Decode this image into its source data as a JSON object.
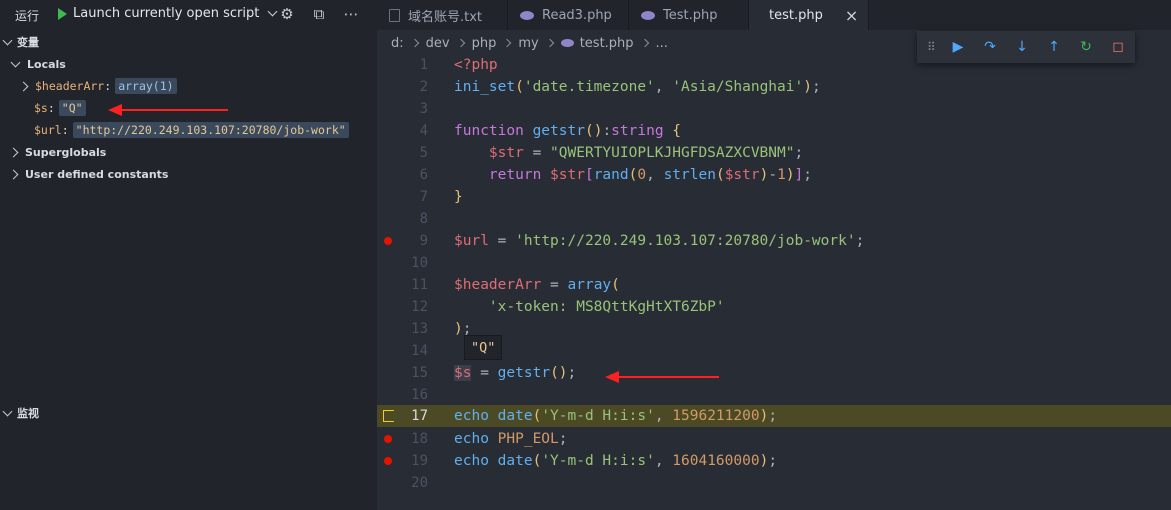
{
  "sidebar": {
    "run_title": "运行",
    "launch_label": "Launch currently open script",
    "variables_title": "变量",
    "locals_label": "Locals",
    "vars": [
      {
        "name": "$headerArr",
        "value": "array(1)"
      },
      {
        "name": "$s",
        "value": "\"Q\""
      },
      {
        "name": "$url",
        "value": "\"http://220.249.103.107:20780/job-work\""
      }
    ],
    "superglobals_label": "Superglobals",
    "constants_label": "User defined constants",
    "watch_title": "监视"
  },
  "tabs": [
    {
      "label": "域名账号.txt",
      "type": "txt"
    },
    {
      "label": "Read3.php",
      "type": "php"
    },
    {
      "label": "Test.php",
      "type": "php"
    },
    {
      "label": "test.php",
      "type": "php",
      "active": true,
      "close": "×"
    }
  ],
  "breadcrumb": [
    "d:",
    "dev",
    "php",
    "my",
    "test.php",
    "..."
  ],
  "hover_value": "\"Q\"",
  "code_lines": [
    "1",
    "2",
    "3",
    "4",
    "5",
    "6",
    "7",
    "8",
    "9",
    "10",
    "11",
    "12",
    "13",
    "14",
    "15",
    "16",
    "17",
    "18",
    "19",
    "20"
  ],
  "colors": {
    "accent_run": "#3fb950",
    "breakpoint": "#e51400",
    "current_line": "#4b4a25",
    "annotation": "#ff2020"
  }
}
